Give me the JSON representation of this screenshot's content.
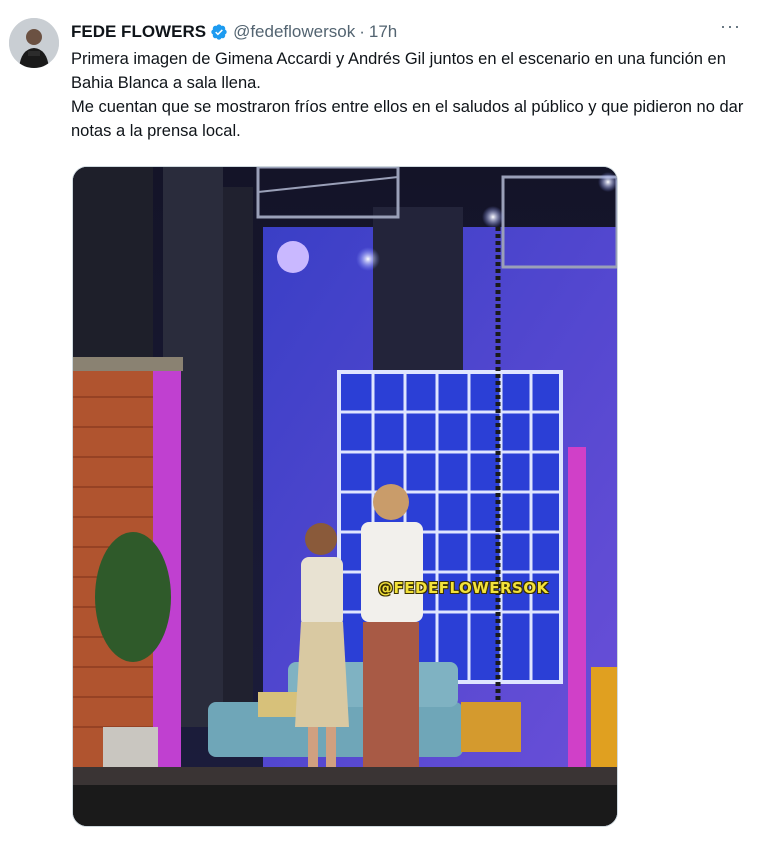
{
  "tweet": {
    "author_name": "FEDE FLOWERS",
    "handle": "@fedeflowersok",
    "separator": "·",
    "time": "17h",
    "more_label": "···",
    "paragraph1": "Primera imagen de Gimena Accardi y Andrés Gil juntos en el escenario en una función en Bahia Blanca a sala llena.",
    "paragraph2": "Me cuentan que se mostraron fríos entre ellos en el saludos al público y que pidieron no dar notas a la prensa local.",
    "verified_icon": "verified-badge-icon",
    "accent_color": "#1d9bf0"
  },
  "media": {
    "watermark": "@FEDEFLOWERSOK"
  }
}
